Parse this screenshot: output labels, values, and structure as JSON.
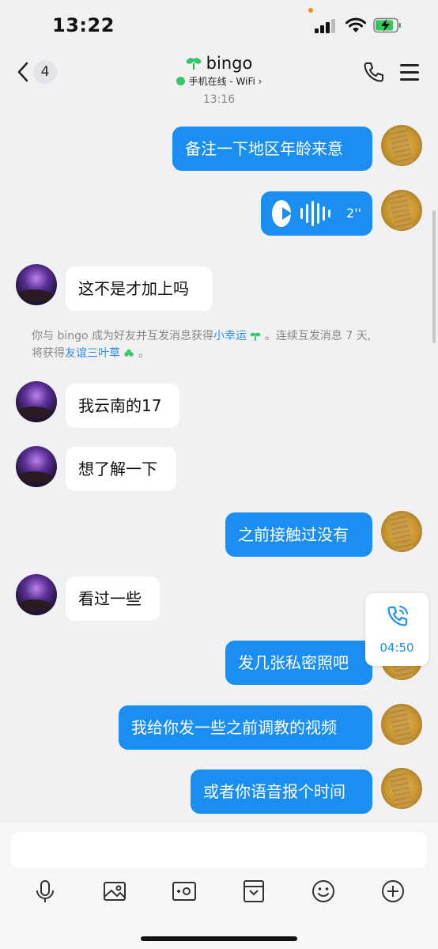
{
  "status": {
    "time": "13:22"
  },
  "nav": {
    "back_count": "4",
    "contact_name": "bingo",
    "presence": "手机在线 - WiFi ›"
  },
  "chat": {
    "timestamp": "13:16",
    "messages": [
      {
        "from": "me",
        "type": "text",
        "text": "备注一下地区年龄来意"
      },
      {
        "from": "me",
        "type": "voice",
        "duration": "2''"
      },
      {
        "from": "other",
        "type": "text",
        "text": "这不是才加上吗"
      },
      {
        "from": "other",
        "type": "text",
        "text": "我云南的17"
      },
      {
        "from": "other",
        "type": "text",
        "text": "想了解一下"
      },
      {
        "from": "me",
        "type": "text",
        "text": "之前接触过没有"
      },
      {
        "from": "other",
        "type": "text",
        "text": "看过一些"
      },
      {
        "from": "me",
        "type": "text",
        "text": "发几张私密照吧"
      },
      {
        "from": "me",
        "type": "text",
        "text": "我给你发一些之前调教的视频"
      },
      {
        "from": "me",
        "type": "text",
        "text": "或者你语音报个时间"
      }
    ],
    "system_notice": {
      "part1": "你与 bingo 成为好友并互发消息获得",
      "link1": "小幸运",
      "part2": "。连续互发消息 7 天,",
      "part3": "将获得",
      "link2": "友谊三叶草",
      "part4": "。"
    }
  },
  "call_widget": {
    "duration": "04:50"
  },
  "input": {
    "placeholder": ""
  },
  "colors": {
    "bubble_me": "#1b8ef2",
    "bubble_other": "#ffffff",
    "background": "#f1f1f3",
    "online": "#34c76b",
    "link": "#2b8ee8"
  },
  "toolbar": [
    "microphone-icon",
    "image-icon",
    "camera-icon",
    "file-icon",
    "emoji-icon",
    "plus-icon"
  ]
}
